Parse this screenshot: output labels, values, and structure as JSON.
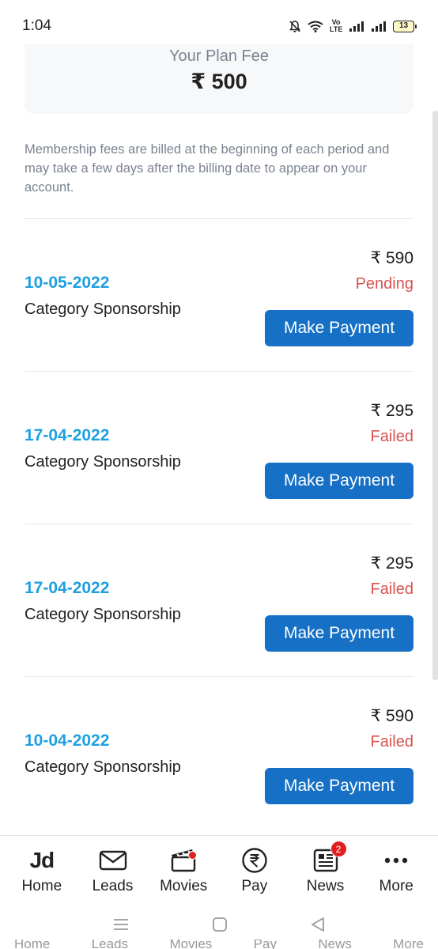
{
  "status_bar": {
    "time": "1:04",
    "volte": "Vo LTE",
    "battery": "13"
  },
  "plan": {
    "label": "Your Plan Fee",
    "value": "₹ 500"
  },
  "info_text": "Membership fees are billed at the beginning of each period and may take a few days after the billing date to appear on your account.",
  "transactions": [
    {
      "amount": "₹ 590",
      "status": "Pending",
      "date": "10-05-2022",
      "category": "Category Sponsorship",
      "button": "Make Payment"
    },
    {
      "amount": "₹ 295",
      "status": "Failed",
      "date": "17-04-2022",
      "category": "Category Sponsorship",
      "button": "Make Payment"
    },
    {
      "amount": "₹ 295",
      "status": "Failed",
      "date": "17-04-2022",
      "category": "Category Sponsorship",
      "button": "Make Payment"
    },
    {
      "amount": "₹ 590",
      "status": "Failed",
      "date": "10-04-2022",
      "category": "Category Sponsorship",
      "button": "Make Payment"
    }
  ],
  "bottom_nav": {
    "items": [
      {
        "label": "Home",
        "icon": "jd-logo-icon",
        "logo_text": "Jd"
      },
      {
        "label": "Leads",
        "icon": "envelope-icon"
      },
      {
        "label": "Movies",
        "icon": "clapperboard-icon"
      },
      {
        "label": "Pay",
        "icon": "rupee-icon"
      },
      {
        "label": "News",
        "icon": "newspaper-icon",
        "badge": "2"
      },
      {
        "label": "More",
        "icon": "more-dots-icon"
      }
    ]
  },
  "system_nav": {
    "icons": [
      "menu-icon",
      "home-square-icon",
      "back-triangle-icon"
    ]
  },
  "colors": {
    "accent_blue": "#1670c5",
    "date_blue": "#1ea0e0",
    "status_red": "#d9534f",
    "muted_text": "#7a8391"
  }
}
